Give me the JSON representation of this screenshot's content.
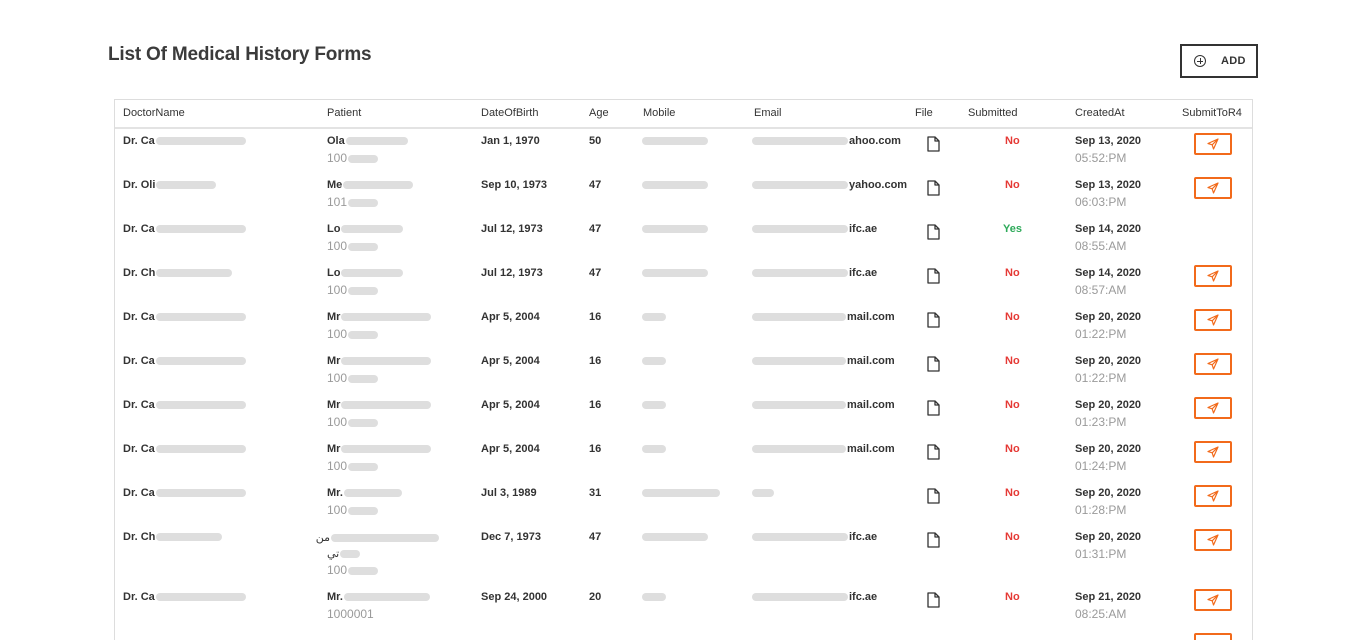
{
  "page": {
    "title": "List Of Medical History Forms",
    "add_label": "ADD"
  },
  "table": {
    "columns": [
      "DoctorName",
      "Patient",
      "DateOfBirth",
      "Age",
      "Mobile",
      "Email",
      "File",
      "Submitted",
      "CreatedAt",
      "SubmitToR4"
    ],
    "rows": [
      {
        "doctor": "Dr. Ca",
        "patient": "Ola",
        "patient_rtl": "",
        "patient_id": "100",
        "dob": "Jan 1, 1970",
        "age": "50",
        "mobile": "",
        "email": "ahoo.com",
        "submitted": "No",
        "created_date": "Sep 13, 2020",
        "created_time": "05:52:PM",
        "can_submit": true
      },
      {
        "doctor": "Dr. Oli",
        "patient": "Me",
        "patient_rtl": "",
        "patient_id": "101",
        "dob": "Sep 10, 1973",
        "age": "47",
        "mobile": "",
        "email": "yahoo.com",
        "submitted": "No",
        "created_date": "Sep 13, 2020",
        "created_time": "06:03:PM",
        "can_submit": true
      },
      {
        "doctor": "Dr. Ca",
        "patient": "Lo",
        "patient_rtl": "",
        "patient_id": "100",
        "dob": "Jul 12, 1973",
        "age": "47",
        "mobile": "",
        "email": "ifc.ae",
        "submitted": "Yes",
        "created_date": "Sep 14, 2020",
        "created_time": "08:55:AM",
        "can_submit": false
      },
      {
        "doctor": "Dr. Ch",
        "patient": "Lo",
        "patient_rtl": "",
        "patient_id": "100",
        "dob": "Jul 12, 1973",
        "age": "47",
        "mobile": "",
        "email": "ifc.ae",
        "submitted": "No",
        "created_date": "Sep 14, 2020",
        "created_time": "08:57:AM",
        "can_submit": true
      },
      {
        "doctor": "Dr. Ca",
        "patient": "Mr",
        "patient_rtl": "",
        "patient_id": "100",
        "dob": "Apr 5, 2004",
        "age": "16",
        "mobile": "",
        "email": "mail.com",
        "submitted": "No",
        "created_date": "Sep 20, 2020",
        "created_time": "01:22:PM",
        "can_submit": true
      },
      {
        "doctor": "Dr. Ca",
        "patient": "Mr",
        "patient_rtl": "",
        "patient_id": "100",
        "dob": "Apr 5, 2004",
        "age": "16",
        "mobile": "",
        "email": "mail.com",
        "submitted": "No",
        "created_date": "Sep 20, 2020",
        "created_time": "01:22:PM",
        "can_submit": true
      },
      {
        "doctor": "Dr. Ca",
        "patient": "Mr",
        "patient_rtl": "",
        "patient_id": "100",
        "dob": "Apr 5, 2004",
        "age": "16",
        "mobile": "",
        "email": "mail.com",
        "submitted": "No",
        "created_date": "Sep 20, 2020",
        "created_time": "01:23:PM",
        "can_submit": true
      },
      {
        "doctor": "Dr. Ca",
        "patient": "Mr",
        "patient_rtl": "",
        "patient_id": "100",
        "dob": "Apr 5, 2004",
        "age": "16",
        "mobile": "",
        "email": "mail.com",
        "submitted": "No",
        "created_date": "Sep 20, 2020",
        "created_time": "01:24:PM",
        "can_submit": true
      },
      {
        "doctor": "Dr. Ca",
        "patient": "Mr.",
        "patient_rtl": "",
        "patient_id": "100",
        "dob": "Jul 3, 1989",
        "age": "31",
        "mobile": "",
        "email": "",
        "submitted": "No",
        "created_date": "Sep 20, 2020",
        "created_time": "01:28:PM",
        "can_submit": true
      },
      {
        "doctor": "Dr. Ch",
        "patient": "من",
        "patient_rtl": "تي",
        "patient_id": "100",
        "dob": "Dec 7, 1973",
        "age": "47",
        "mobile": "",
        "email": "ifc.ae",
        "submitted": "No",
        "created_date": "Sep 20, 2020",
        "created_time": "01:31:PM",
        "can_submit": true
      },
      {
        "doctor": "Dr. Ca",
        "patient": "Mr.",
        "patient_rtl": "",
        "patient_id": "1000001",
        "dob": "Sep 24, 2000",
        "age": "20",
        "mobile": "",
        "email": "ifc.ae",
        "submitted": "No",
        "created_date": "Sep 21, 2020",
        "created_time": "08:25:AM",
        "can_submit": true
      }
    ]
  },
  "colors": {
    "no": "#e53935",
    "yes": "#2eaa5a",
    "submit_accent": "#f26a1b"
  },
  "icons": {
    "add": "plus-circle-icon",
    "file": "file-icon",
    "submit": "paper-plane-icon"
  }
}
